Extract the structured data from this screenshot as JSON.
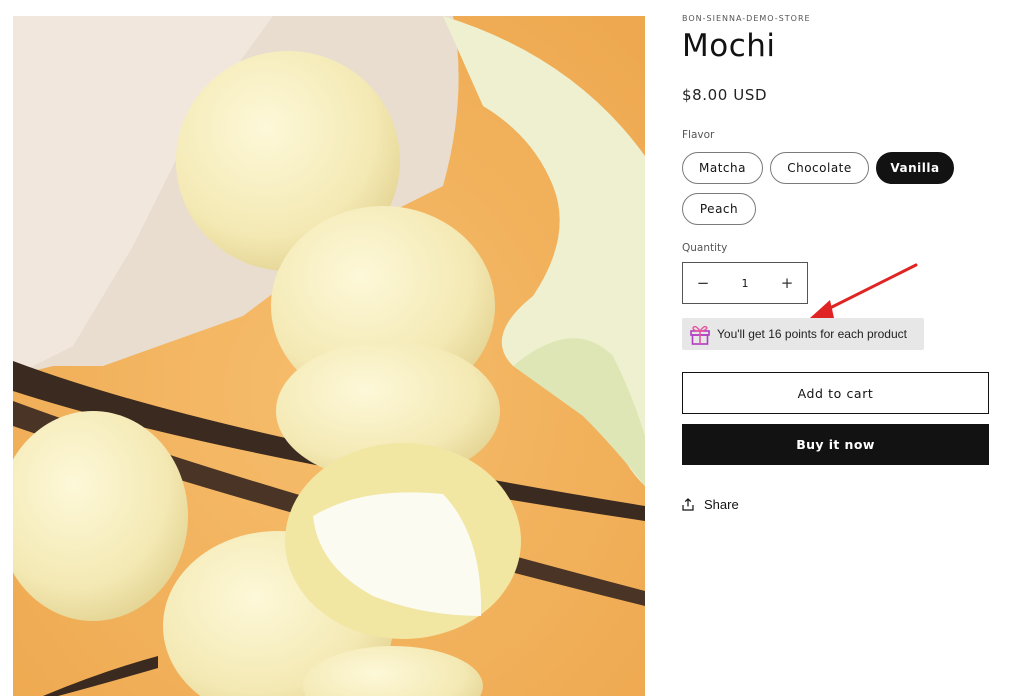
{
  "product": {
    "vendor": "BON-SIENNA-DEMO-STORE",
    "title": "Mochi",
    "price": "$8.00 USD",
    "image_alt": "Vanilla mochi with vanilla beans and calla lily on orange background"
  },
  "flavor": {
    "label": "Flavor",
    "options": [
      "Matcha",
      "Chocolate",
      "Vanilla",
      "Peach"
    ],
    "selected": "Vanilla"
  },
  "quantity": {
    "label": "Quantity",
    "value": "1",
    "decrease_symbol": "−",
    "increase_symbol": "+"
  },
  "points": {
    "text": "You'll get 16 points for each product",
    "icon": "gift-icon"
  },
  "actions": {
    "add_to_cart": "Add to cart",
    "buy_now": "Buy it now",
    "share": "Share"
  },
  "colors": {
    "accent": "#121212",
    "image_bg": "#f3b25a",
    "points_bg": "#e7e7e7",
    "annotation_arrow": "#e02424"
  }
}
